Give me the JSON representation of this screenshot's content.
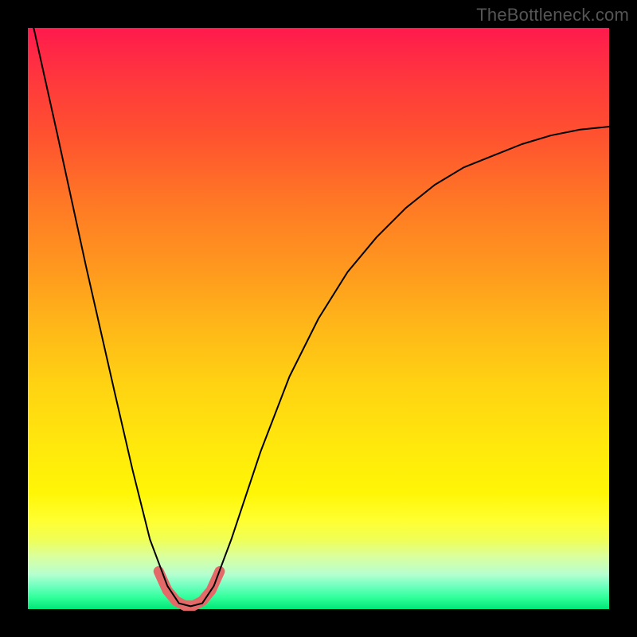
{
  "watermark": "TheBottleneck.com",
  "chart_data": {
    "type": "line",
    "title": "",
    "xlabel": "",
    "ylabel": "",
    "xlim": [
      0,
      100
    ],
    "ylim": [
      0,
      100
    ],
    "grid": false,
    "legend": false,
    "series": [
      {
        "name": "bottleneck-curve",
        "color": "#000000",
        "stroke_width": 2,
        "x": [
          1,
          5,
          10,
          15,
          18,
          21,
          24,
          26,
          28,
          30,
          32,
          35,
          40,
          45,
          50,
          55,
          60,
          65,
          70,
          75,
          80,
          85,
          90,
          95,
          100
        ],
        "y": [
          100,
          82,
          59,
          37,
          24,
          12,
          4,
          1,
          0.5,
          1,
          4,
          12,
          27,
          40,
          50,
          58,
          64,
          69,
          73,
          76,
          78,
          80,
          81.5,
          82.5,
          83
        ]
      },
      {
        "name": "optimal-range-highlight",
        "color": "#e46a6a",
        "stroke_width": 13,
        "x": [
          22.5,
          24,
          25.5,
          27,
          28.5,
          30,
          31.5,
          33
        ],
        "y": [
          6.5,
          3.2,
          1.4,
          0.6,
          0.6,
          1.4,
          3.2,
          6.5
        ]
      }
    ],
    "annotations": []
  }
}
